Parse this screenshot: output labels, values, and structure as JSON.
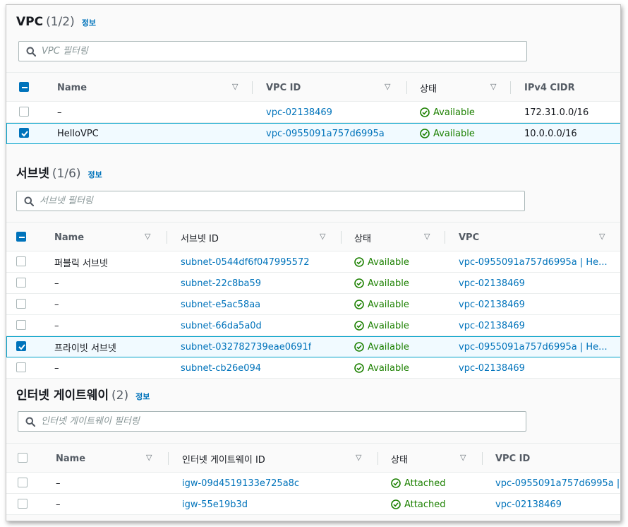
{
  "vpc": {
    "title": "VPC",
    "count": "(1/2)",
    "info": "정보",
    "filter_placeholder": "VPC 필터링",
    "columns": [
      "Name",
      "VPC ID",
      "상태",
      "IPv4 CIDR"
    ],
    "rows": [
      {
        "name": "–",
        "id": "vpc-02138469",
        "status": "Available",
        "cidr": "172.31.0.0/16",
        "checked": false
      },
      {
        "name": "HelloVPC",
        "id": "vpc-0955091a757d6995a",
        "status": "Available",
        "cidr": "10.0.0.0/16",
        "checked": true
      }
    ]
  },
  "subnet": {
    "title": "서브넷",
    "count": "(1/6)",
    "info": "정보",
    "filter_placeholder": "서브넷 필터링",
    "columns": [
      "Name",
      "서브넷 ID",
      "상태",
      "VPC"
    ],
    "rows": [
      {
        "name": "퍼블릭 서브넷",
        "id": "subnet-0544df6f047995572",
        "status": "Available",
        "vpc": "vpc-0955091a757d6995a | He...",
        "checked": false
      },
      {
        "name": "–",
        "id": "subnet-22c8ba59",
        "status": "Available",
        "vpc": "vpc-02138469",
        "checked": false
      },
      {
        "name": "–",
        "id": "subnet-e5ac58aa",
        "status": "Available",
        "vpc": "vpc-02138469",
        "checked": false
      },
      {
        "name": "–",
        "id": "subnet-66da5a0d",
        "status": "Available",
        "vpc": "vpc-02138469",
        "checked": false
      },
      {
        "name": "프라이빗 서브넷",
        "id": "subnet-032782739eae0691f",
        "status": "Available",
        "vpc": "vpc-0955091a757d6995a | He...",
        "checked": true
      },
      {
        "name": "–",
        "id": "subnet-cb26e094",
        "status": "Available",
        "vpc": "vpc-02138469",
        "checked": false
      }
    ]
  },
  "igw": {
    "title": "인터넷 게이트웨이",
    "count": "(2)",
    "info": "정보",
    "filter_placeholder": "인터넷 게이트웨이 필터링",
    "columns": [
      "Name",
      "인터넷 게이트웨이 ID",
      "상태",
      "VPC ID"
    ],
    "rows": [
      {
        "name": "–",
        "id": "igw-09d4519133e725a8c",
        "status": "Attached",
        "vpc": "vpc-0955091a757d6995a |",
        "checked": false
      },
      {
        "name": "–",
        "id": "igw-55e19b3d",
        "status": "Attached",
        "vpc": "vpc-02138469",
        "checked": false
      }
    ]
  },
  "colors": {
    "link": "#0073bb",
    "success": "#1d8102",
    "selected_bg": "#f1faff",
    "selected_border": "#00a1c9"
  },
  "icons": {
    "search": "search-icon",
    "sort": "caret-down-icon",
    "status_ok": "check-circle-icon",
    "checkbox_checked": "checkbox-checked-icon",
    "checkbox_indeterminate": "checkbox-indeterminate-icon"
  }
}
